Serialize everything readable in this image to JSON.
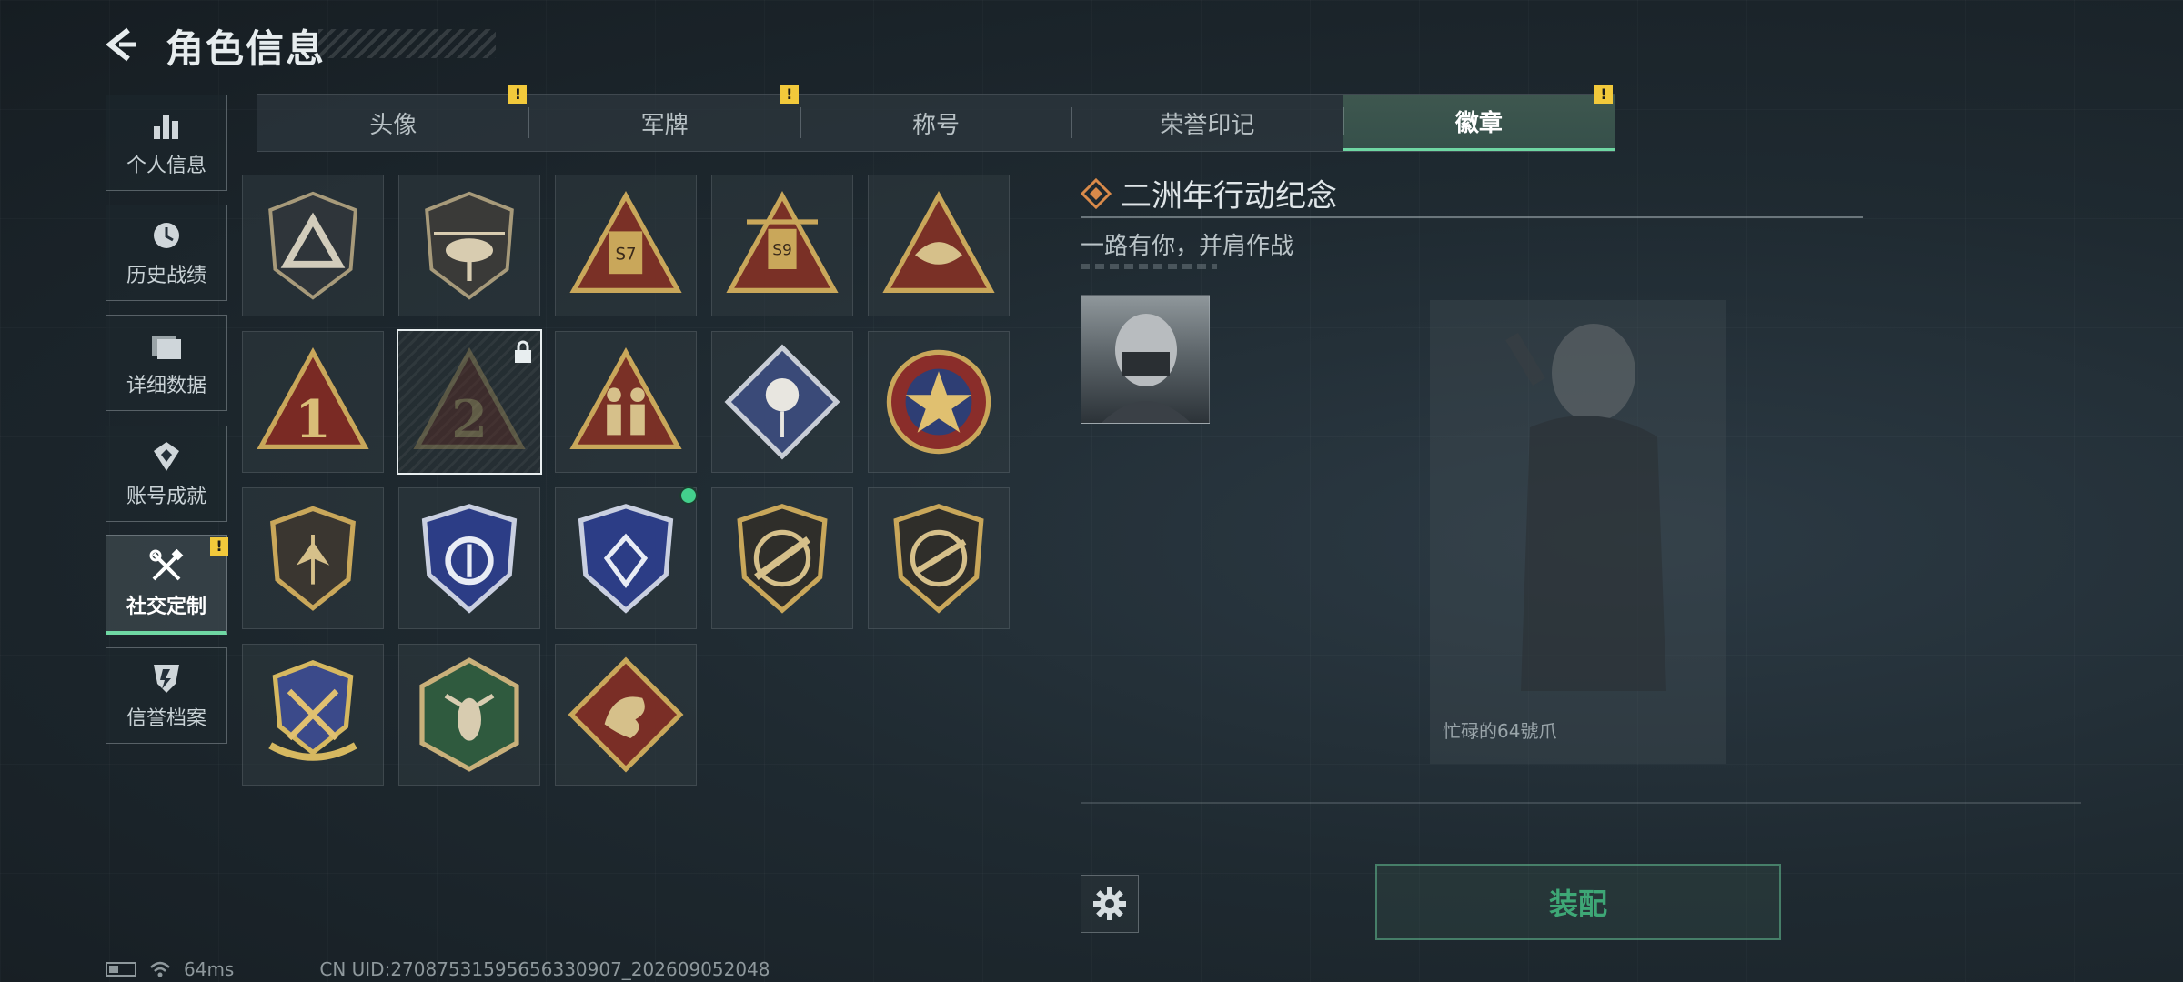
{
  "header": {
    "title": "角色信息"
  },
  "nav": [
    {
      "label": "个人信息",
      "icon": "bar-chart-icon"
    },
    {
      "label": "历史战绩",
      "icon": "clock-icon"
    },
    {
      "label": "详细数据",
      "icon": "folder-icon"
    },
    {
      "label": "账号成就",
      "icon": "achievement-icon"
    },
    {
      "label": "社交定制",
      "icon": "tools-icon",
      "active": true,
      "alert": "!"
    },
    {
      "label": "信誉档案",
      "icon": "shield-icon"
    }
  ],
  "tabs": [
    {
      "label": "头像",
      "alert": "!"
    },
    {
      "label": "军牌",
      "alert": "!"
    },
    {
      "label": "称号"
    },
    {
      "label": "荣誉印记"
    },
    {
      "label": "徽章",
      "active": true,
      "alert": "!"
    }
  ],
  "badges": [
    {
      "name": "triangle-emblem-shield"
    },
    {
      "name": "helicopter-shield"
    },
    {
      "name": "s7-triangle"
    },
    {
      "name": "s9-triangle"
    },
    {
      "name": "mask-triangle"
    },
    {
      "name": "number-1-triangle"
    },
    {
      "name": "number-2-triangle",
      "locked": true,
      "selected": true
    },
    {
      "name": "soldiers-triangle"
    },
    {
      "name": "rose-diamond"
    },
    {
      "name": "star-skull-roundel"
    },
    {
      "name": "arrow-shield-gold"
    },
    {
      "name": "blue-shield-stars"
    },
    {
      "name": "diamond-shield-equipped",
      "equipped": true
    },
    {
      "name": "rifle-shield"
    },
    {
      "name": "rifle-shield-alt"
    },
    {
      "name": "crossed-blades-crest"
    },
    {
      "name": "wasp-hexagon"
    },
    {
      "name": "dragon-diamond"
    }
  ],
  "detail": {
    "title": "二洲年行动纪念",
    "subtitle": "一路有你，并肩作战"
  },
  "character": {
    "name": "忙碌的64號爪"
  },
  "equip": {
    "label": "装配"
  },
  "status": {
    "ping": "64ms",
    "uid": "CN UID:2708753159565633090​7_202609052048"
  },
  "colors": {
    "accent": "#6fd7a3",
    "alert": "#f2c93b",
    "gold": "#c9a75a"
  }
}
